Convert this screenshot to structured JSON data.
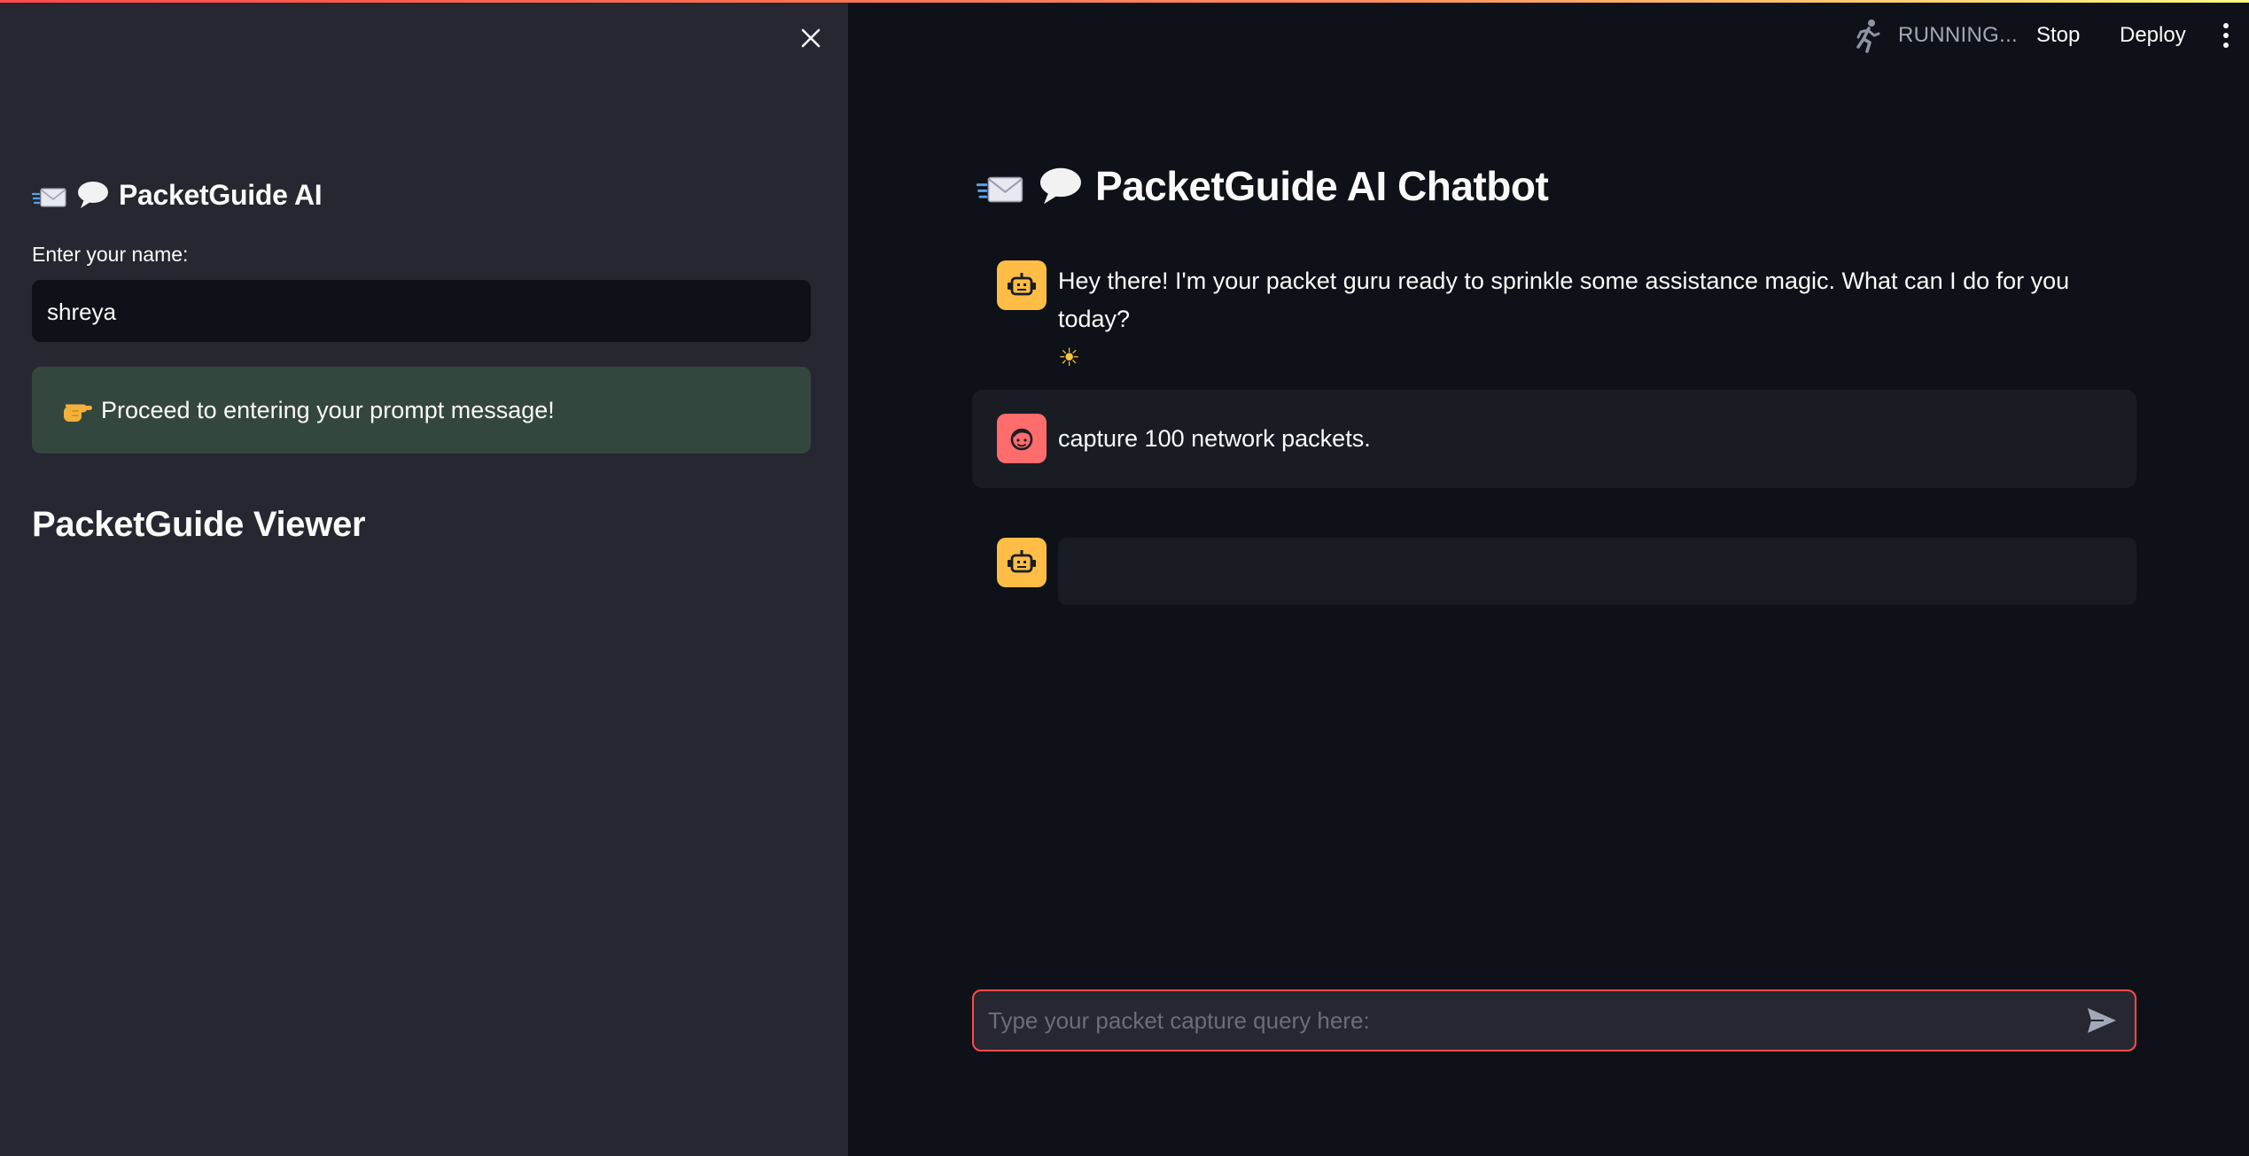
{
  "colors": {
    "background": "#0e1117",
    "sidebar": "#262730",
    "accent": "#ff4b4b",
    "info_box": "#33473e",
    "bot_avatar": "#ffbd45",
    "user_avatar": "#ff6c6c"
  },
  "header": {
    "status": "RUNNING...",
    "stop_label": "Stop",
    "deploy_label": "Deploy"
  },
  "sidebar": {
    "title": "PacketGuide AI",
    "name_label": "Enter your name:",
    "name_value": "shreya",
    "info_message": "Proceed to entering your prompt message!",
    "viewer_title": "PacketGuide Viewer"
  },
  "main": {
    "title": "PacketGuide AI Chatbot",
    "messages": [
      {
        "role": "assistant",
        "text": "Hey there! I'm your packet guru ready to sprinkle some assistance magic. What can I do for you today?"
      },
      {
        "role": "user",
        "text": "capture 100 network packets."
      },
      {
        "role": "assistant",
        "text": ""
      }
    ],
    "chat_input_placeholder": "Type your packet capture query here:"
  }
}
